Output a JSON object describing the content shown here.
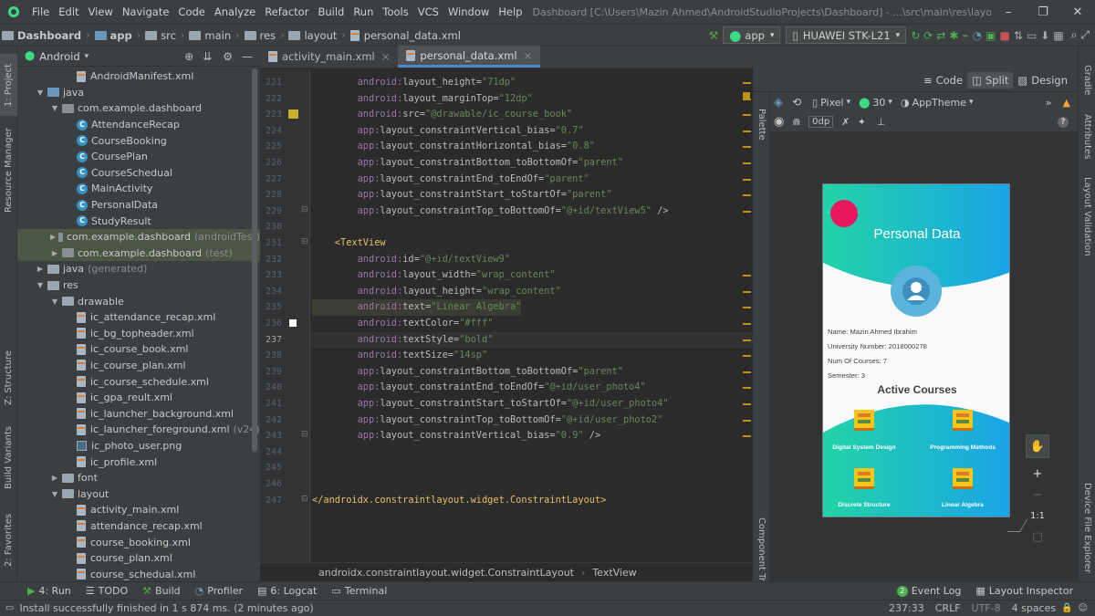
{
  "menu": {
    "items": [
      "File",
      "Edit",
      "View",
      "Navigate",
      "Code",
      "Analyze",
      "Refactor",
      "Build",
      "Run",
      "Tools",
      "VCS",
      "Window",
      "Help"
    ],
    "window_title": "Dashboard [C:\\Users\\Mazin Ahmed\\AndroidStudioProjects\\Dashboard] - ...\\src\\main\\res\\layout\\personal_data.xml [app]"
  },
  "nav": {
    "crumbs": [
      "Dashboard",
      "app",
      "src",
      "main",
      "res",
      "layout",
      "personal_data.xml"
    ],
    "run_config": "app",
    "device": "HUAWEI STK-L21"
  },
  "project": {
    "view_mode": "Android",
    "tree": [
      {
        "label": "AndroidManifest.xml",
        "indent": 3,
        "icon": "manifest",
        "tw": ""
      },
      {
        "label": "java",
        "indent": 1,
        "icon": "folder",
        "tw": "v"
      },
      {
        "label": "com.example.dashboard",
        "indent": 2,
        "icon": "package",
        "tw": "v"
      },
      {
        "label": "AttendanceRecap",
        "indent": 3,
        "icon": "class",
        "tw": ""
      },
      {
        "label": "CourseBooking",
        "indent": 3,
        "icon": "class",
        "tw": ""
      },
      {
        "label": "CoursePlan",
        "indent": 3,
        "icon": "class",
        "tw": ""
      },
      {
        "label": "CourseSchedual",
        "indent": 3,
        "icon": "class",
        "tw": ""
      },
      {
        "label": "MainActivity",
        "indent": 3,
        "icon": "class",
        "tw": ""
      },
      {
        "label": "PersonalData",
        "indent": 3,
        "icon": "class",
        "tw": ""
      },
      {
        "label": "StudyResult",
        "indent": 3,
        "icon": "class",
        "tw": ""
      },
      {
        "label": "com.example.dashboard",
        "suffix": "(androidTest)",
        "indent": 2,
        "icon": "package",
        "tw": ">",
        "sel": true
      },
      {
        "label": "com.example.dashboard",
        "suffix": "(test)",
        "indent": 2,
        "icon": "package",
        "tw": ">",
        "sel": true
      },
      {
        "label": "java",
        "suffix": "(generated)",
        "indent": 1,
        "icon": "folder",
        "tw": ">"
      },
      {
        "label": "res",
        "indent": 1,
        "icon": "folder",
        "tw": "v"
      },
      {
        "label": "drawable",
        "indent": 2,
        "icon": "folder",
        "tw": "v"
      },
      {
        "label": "ic_attendance_recap.xml",
        "indent": 3,
        "icon": "xml",
        "tw": ""
      },
      {
        "label": "ic_bg_topheader.xml",
        "indent": 3,
        "icon": "xml",
        "tw": ""
      },
      {
        "label": "ic_course_book.xml",
        "indent": 3,
        "icon": "xml",
        "tw": ""
      },
      {
        "label": "ic_course_plan.xml",
        "indent": 3,
        "icon": "xml",
        "tw": ""
      },
      {
        "label": "ic_course_schedule.xml",
        "indent": 3,
        "icon": "xml",
        "tw": ""
      },
      {
        "label": "ic_gpa_reult.xml",
        "indent": 3,
        "icon": "xml",
        "tw": ""
      },
      {
        "label": "ic_launcher_background.xml",
        "indent": 3,
        "icon": "xml",
        "tw": ""
      },
      {
        "label": "ic_launcher_foreground.xml",
        "suffix": "(v24)",
        "indent": 3,
        "icon": "xml",
        "tw": ""
      },
      {
        "label": "ic_photo_user.png",
        "indent": 3,
        "icon": "img",
        "tw": ""
      },
      {
        "label": "ic_profile.xml",
        "indent": 3,
        "icon": "xml",
        "tw": ""
      },
      {
        "label": "font",
        "indent": 2,
        "icon": "folder",
        "tw": ">"
      },
      {
        "label": "layout",
        "indent": 2,
        "icon": "folder",
        "tw": "v"
      },
      {
        "label": "activity_main.xml",
        "indent": 3,
        "icon": "xml",
        "tw": ""
      },
      {
        "label": "attendance_recap.xml",
        "indent": 3,
        "icon": "xml",
        "tw": ""
      },
      {
        "label": "course_booking.xml",
        "indent": 3,
        "icon": "xml",
        "tw": ""
      },
      {
        "label": "course_plan.xml",
        "indent": 3,
        "icon": "xml",
        "tw": ""
      },
      {
        "label": "course_schedual.xml",
        "indent": 3,
        "icon": "xml",
        "tw": ""
      }
    ]
  },
  "editor": {
    "tabs": [
      "activity_main.xml",
      "personal_data.xml"
    ],
    "active_tab": 1,
    "current_line": 237,
    "lines": [
      {
        "n": 221,
        "parts": [
          [
            "ns",
            "        android:"
          ],
          [
            "at",
            "layout_height="
          ],
          [
            "vs",
            "\"71dp\""
          ]
        ]
      },
      {
        "n": 222,
        "parts": [
          [
            "ns",
            "        android:"
          ],
          [
            "at",
            "layout_marginTop="
          ],
          [
            "vs",
            "\"12dp\""
          ]
        ]
      },
      {
        "n": 223,
        "parts": [
          [
            "ns",
            "        android:"
          ],
          [
            "at",
            "src="
          ],
          [
            "vs",
            "\"@drawable/ic_course_book\""
          ]
        ]
      },
      {
        "n": 224,
        "parts": [
          [
            "ns",
            "        app:"
          ],
          [
            "at",
            "layout_constraintVertical_bias="
          ],
          [
            "vs",
            "\"0.7\""
          ]
        ]
      },
      {
        "n": 225,
        "parts": [
          [
            "ns",
            "        app:"
          ],
          [
            "at",
            "layout_constraintHorizontal_bias="
          ],
          [
            "vs",
            "\"0.8\""
          ]
        ]
      },
      {
        "n": 226,
        "parts": [
          [
            "ns",
            "        app:"
          ],
          [
            "at",
            "layout_constraintBottom_toBottomOf="
          ],
          [
            "vs",
            "\"parent\""
          ]
        ]
      },
      {
        "n": 227,
        "parts": [
          [
            "ns",
            "        app:"
          ],
          [
            "at",
            "layout_constraintEnd_toEndOf="
          ],
          [
            "vs",
            "\"parent\""
          ]
        ]
      },
      {
        "n": 228,
        "parts": [
          [
            "ns",
            "        app:"
          ],
          [
            "at",
            "layout_constraintStart_toStartOf="
          ],
          [
            "vs",
            "\"parent\""
          ]
        ]
      },
      {
        "n": 229,
        "parts": [
          [
            "ns",
            "        app:"
          ],
          [
            "at",
            "layout_constraintTop_toBottomOf="
          ],
          [
            "vs",
            "\"@+id/textView5\""
          ],
          [
            "at",
            " />"
          ]
        ]
      },
      {
        "n": 230,
        "parts": []
      },
      {
        "n": 231,
        "parts": [
          [
            "tg",
            "    <TextView"
          ]
        ]
      },
      {
        "n": 232,
        "parts": [
          [
            "ns",
            "        android:"
          ],
          [
            "at",
            "id="
          ],
          [
            "vs",
            "\"@+id/textView9\""
          ]
        ]
      },
      {
        "n": 233,
        "parts": [
          [
            "ns",
            "        android:"
          ],
          [
            "at",
            "layout_width="
          ],
          [
            "vs",
            "\"wrap_content\""
          ]
        ]
      },
      {
        "n": 234,
        "parts": [
          [
            "ns",
            "        android:"
          ],
          [
            "at",
            "layout_height="
          ],
          [
            "vs",
            "\"wrap_content\""
          ]
        ]
      },
      {
        "n": 235,
        "parts": [
          [
            "ns",
            "        android:"
          ],
          [
            "at",
            "text="
          ],
          [
            "vs",
            "\"Linear Algebra\""
          ]
        ]
      },
      {
        "n": 236,
        "parts": [
          [
            "ns",
            "        android:"
          ],
          [
            "at",
            "textColor="
          ],
          [
            "vs",
            "\"#fff\""
          ]
        ]
      },
      {
        "n": 237,
        "parts": [
          [
            "ns",
            "        android:"
          ],
          [
            "at",
            "textStyle="
          ],
          [
            "vs",
            "\"bold\""
          ]
        ]
      },
      {
        "n": 238,
        "parts": [
          [
            "ns",
            "        android:"
          ],
          [
            "at",
            "textSize="
          ],
          [
            "vs",
            "\"14sp\""
          ]
        ]
      },
      {
        "n": 239,
        "parts": [
          [
            "ns",
            "        app:"
          ],
          [
            "at",
            "layout_constraintBottom_toBottomOf="
          ],
          [
            "vs",
            "\"parent\""
          ]
        ]
      },
      {
        "n": 240,
        "parts": [
          [
            "ns",
            "        app:"
          ],
          [
            "at",
            "layout_constraintEnd_toEndOf="
          ],
          [
            "vs",
            "\"@+id/user_photo4\""
          ]
        ]
      },
      {
        "n": 241,
        "parts": [
          [
            "ns",
            "        app:"
          ],
          [
            "at",
            "layout_constraintStart_toStartOf="
          ],
          [
            "vs",
            "\"@+id/user_photo4\""
          ]
        ]
      },
      {
        "n": 242,
        "parts": [
          [
            "ns",
            "        app:"
          ],
          [
            "at",
            "layout_constraintTop_toBottomOf="
          ],
          [
            "vs",
            "\"@+id/user_photo2\""
          ]
        ]
      },
      {
        "n": 243,
        "parts": [
          [
            "ns",
            "        app:"
          ],
          [
            "at",
            "layout_constraintVertical_bias="
          ],
          [
            "vs",
            "\"0.9\""
          ],
          [
            "at",
            " />"
          ]
        ]
      },
      {
        "n": 244,
        "parts": []
      },
      {
        "n": 245,
        "parts": []
      },
      {
        "n": 246,
        "parts": []
      },
      {
        "n": 247,
        "parts": [
          [
            "tg",
            "</androidx.constraintlayout.widget.ConstraintLayout>"
          ]
        ]
      }
    ],
    "breadcrumb": [
      "androidx.constraintlayout.widget.ConstraintLayout",
      "TextView"
    ]
  },
  "design": {
    "modes": [
      "Code",
      "Split",
      "Design"
    ],
    "active_mode": "Split",
    "device": "Pixel",
    "api": "30",
    "theme": "AppTheme",
    "margin": "0dp",
    "palette_label": "Palette",
    "component_tree_label": "Component Tree",
    "zoom_fit": "1:1"
  },
  "preview": {
    "title": "Personal Data",
    "fields": [
      "Name: Mazin Ahmed Ibrahim",
      "University Number: 2018000278",
      "Num Of Courses: 7",
      "Semester: 3"
    ],
    "section": "Active Courses",
    "courses": [
      "Digital System Design",
      "Programming Methods",
      "Discrete Structure",
      "Linear Algebra"
    ],
    "colors": {
      "gradient_start": "#22d3a6",
      "gradient_end": "#1aa3e8",
      "dot": "#e8185c",
      "avatar": "#5ab4dc"
    }
  },
  "right_tabs": [
    "Gradle",
    "Attributes",
    "Layout Validation",
    "Device File Explorer"
  ],
  "left_tabs": [
    "1: Project",
    "Resource Manager",
    "Z: Structure",
    "Build Variants",
    "2: Favorites"
  ],
  "bottom": {
    "tabs": [
      "4: Run",
      "TODO",
      "Build",
      "Profiler",
      "6: Logcat",
      "Terminal"
    ],
    "right_tabs": [
      "Event Log",
      "Layout Inspector"
    ],
    "event_count": "2"
  },
  "status": {
    "message": "Install successfully finished in 1 s 874 ms. (2 minutes ago)",
    "position": "237:33",
    "line_sep": "CRLF",
    "encoding": "UTF-8",
    "indent": "4 spaces"
  }
}
